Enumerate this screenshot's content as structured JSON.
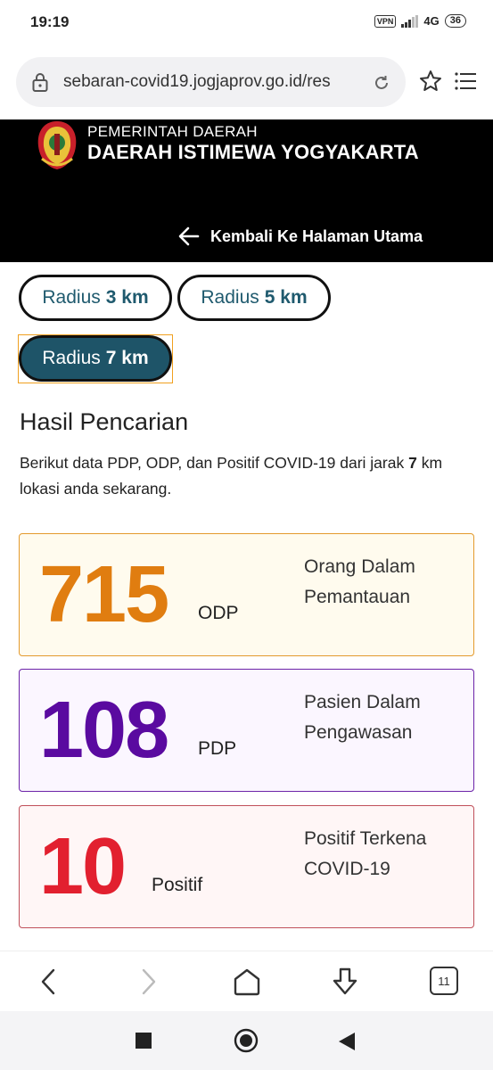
{
  "status_bar": {
    "time": "19:19",
    "vpn": "VPN",
    "network": "4G",
    "battery": "36"
  },
  "browser": {
    "url": "sebaran-covid19.jogjaprov.go.id/res",
    "tab_count": "11"
  },
  "header": {
    "line1": "PEMERINTAH DAERAH",
    "line2": "DAERAH ISTIMEWA YOGYAKARTA",
    "back_label": "Kembali Ke Halaman Utama"
  },
  "radius": {
    "prefix": "Radius",
    "options": [
      {
        "value": "3 km"
      },
      {
        "value": "5 km"
      },
      {
        "value": "7 km"
      }
    ],
    "selected": "7 km"
  },
  "results": {
    "title": "Hasil Pencarian",
    "desc_before": "Berikut data PDP, ODP, dan Positif COVID-19 dari jarak ",
    "desc_distance": "7",
    "desc_after": " km lokasi anda sekarang."
  },
  "stats": [
    {
      "number": "715",
      "abbr": "ODP",
      "desc_line1": "Orang Dalam",
      "desc_line2": "Pemantauan"
    },
    {
      "number": "108",
      "abbr": "PDP",
      "desc_line1": "Pasien Dalam",
      "desc_line2": "Pengawasan"
    },
    {
      "number": "10",
      "abbr": "Positif",
      "desc_line1": "Positif Terkena",
      "desc_line2": "COVID-19"
    }
  ],
  "colors": {
    "odp": "#e07d10",
    "pdp": "#5a0aa0",
    "positif": "#e2202f",
    "radius_active": "#1e5468"
  },
  "icons": {
    "lock": "lock-icon",
    "reload": "reload-icon",
    "star": "star-icon",
    "menu": "menu-icon",
    "back": "arrow-left-icon"
  }
}
